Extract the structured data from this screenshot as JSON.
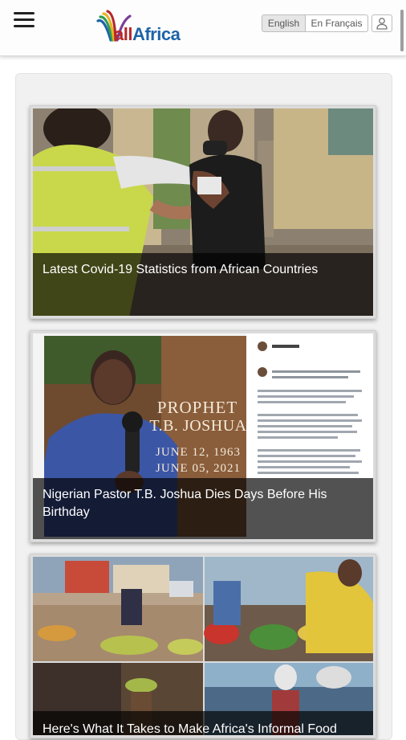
{
  "header": {
    "menu_icon": "hamburger-menu-icon",
    "logo_text_all": "all",
    "logo_text_africa": "Africa",
    "lang_english": "English",
    "lang_french": "En Français",
    "user_icon": "user-icon"
  },
  "feed": {
    "articles": [
      {
        "title": "Latest Covid-19 Statistics from African Countries"
      },
      {
        "title": "Nigerian Pastor T.B. Joshua Dies Days Before His Birthday"
      },
      {
        "title": "Here's What It Takes to Make Africa's Informal Food"
      }
    ],
    "card2_image": {
      "prophet_line1": "PROPHET",
      "prophet_line2": "T.B. JOSHUA",
      "date1": "JUNE 12, 1963",
      "date2": "JUNE 05, 2021"
    }
  },
  "colors": {
    "logo_red": "#b5282b",
    "logo_blue": "#1e63a8",
    "caption_bg": "rgba(0,0,0,0.68)"
  }
}
